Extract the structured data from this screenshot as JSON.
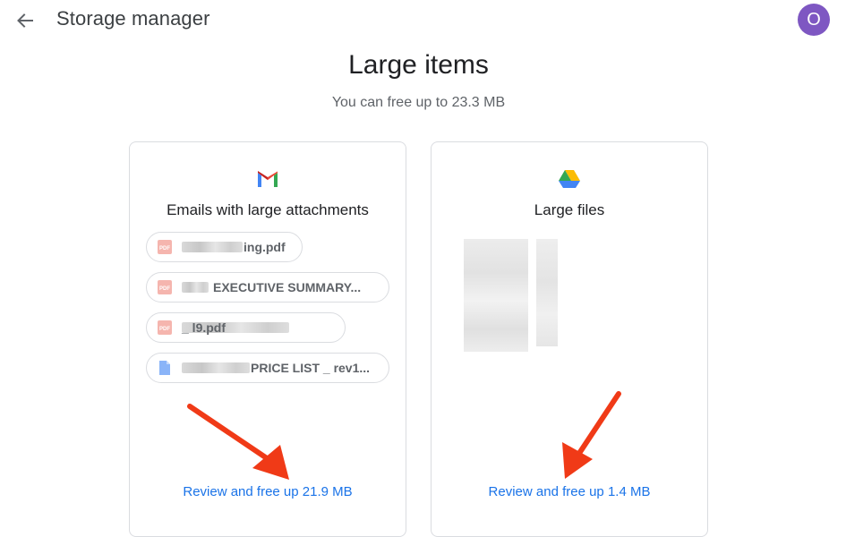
{
  "header": {
    "title": "Storage manager",
    "avatar_letter": "O"
  },
  "main": {
    "title": "Large items",
    "subtitle": "You can free up to 23.3 MB"
  },
  "cards": {
    "gmail": {
      "icon": "gmail-icon",
      "title": "Emails with large attachments",
      "attachments": [
        {
          "icon": "pdf-icon",
          "name": "ing.pdf"
        },
        {
          "icon": "pdf-icon",
          "name": "EXECUTIVE SUMMARY..."
        },
        {
          "icon": "pdf-icon",
          "name": "_        l9.pdf"
        },
        {
          "icon": "doc-icon",
          "name": "PRICE LIST _ rev1..."
        }
      ],
      "action": "Review and free up 21.9 MB"
    },
    "drive": {
      "icon": "google-drive-icon",
      "title": "Large files",
      "action": "Review and free up 1.4 MB"
    }
  },
  "colors": {
    "accent": "#1a73e8",
    "avatar": "#7e57c2",
    "annotation_arrow": "#f03a17"
  }
}
